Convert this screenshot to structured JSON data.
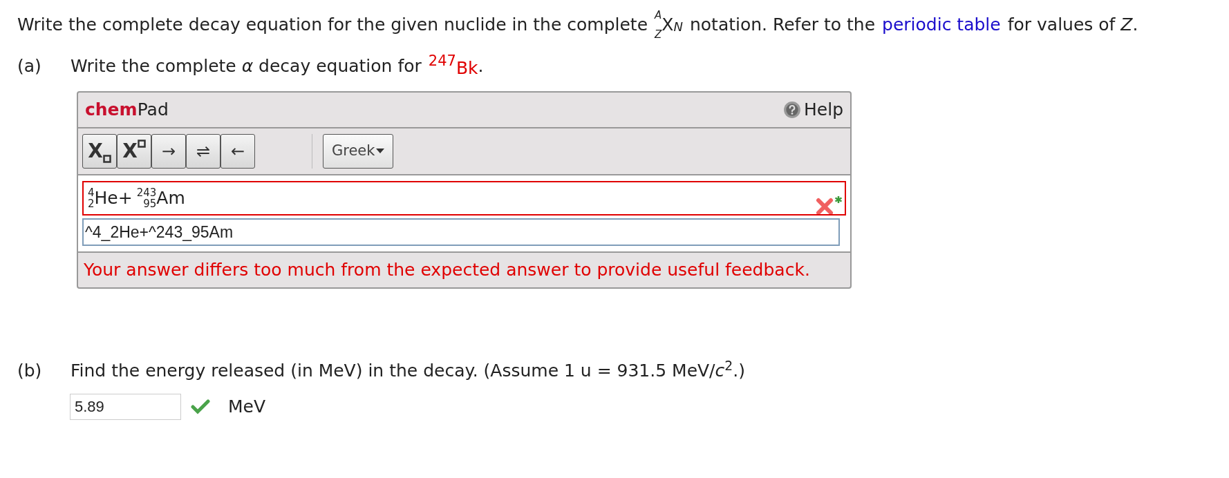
{
  "intro": {
    "before": "Write the complete decay equation for the given nuclide in the complete",
    "notation": {
      "mass": "A",
      "atomic": "Z",
      "symbol": "X",
      "neutron": "N"
    },
    "after": "notation. Refer to the",
    "link": "periodic table",
    "end": "for values of *Z*."
  },
  "part_a": {
    "label": "(a)",
    "question": "Write the complete *α* decay equation for",
    "nuclide": {
      "mass": "247",
      "symbol": "Bk"
    },
    "end": ".",
    "chempad": {
      "brand_bold": "chem",
      "brand": "Pad",
      "help": "Help",
      "tools": [
        {
          "kind": "sub",
          "text": "X"
        },
        {
          "kind": "sup",
          "text": "X"
        },
        {
          "kind": "arrow",
          "text": "→"
        },
        {
          "kind": "arrow",
          "text": "⇌"
        },
        {
          "kind": "arrow",
          "text": "←"
        }
      ],
      "greek": "Greek",
      "equation": [
        {
          "kind": "nuclide",
          "mass": "4",
          "atomic": "2",
          "symbol": "He"
        },
        {
          "kind": "operator",
          "text": "+"
        },
        {
          "kind": "nuclide",
          "mass": "243",
          "atomic": "95",
          "symbol": "Am"
        }
      ],
      "correct": false,
      "input": "^4_2He+^243_95Am",
      "feedback": "Your answer differs too much from the expected answer to provide useful feedback."
    }
  },
  "part_b": {
    "label": "(b)",
    "question": "Find the energy released (in MeV) in the decay. (Assume 1 u = 931.5 MeV/*c*$^{2}$.)",
    "value": "5.89",
    "correct": true,
    "unit": "MeV"
  }
}
